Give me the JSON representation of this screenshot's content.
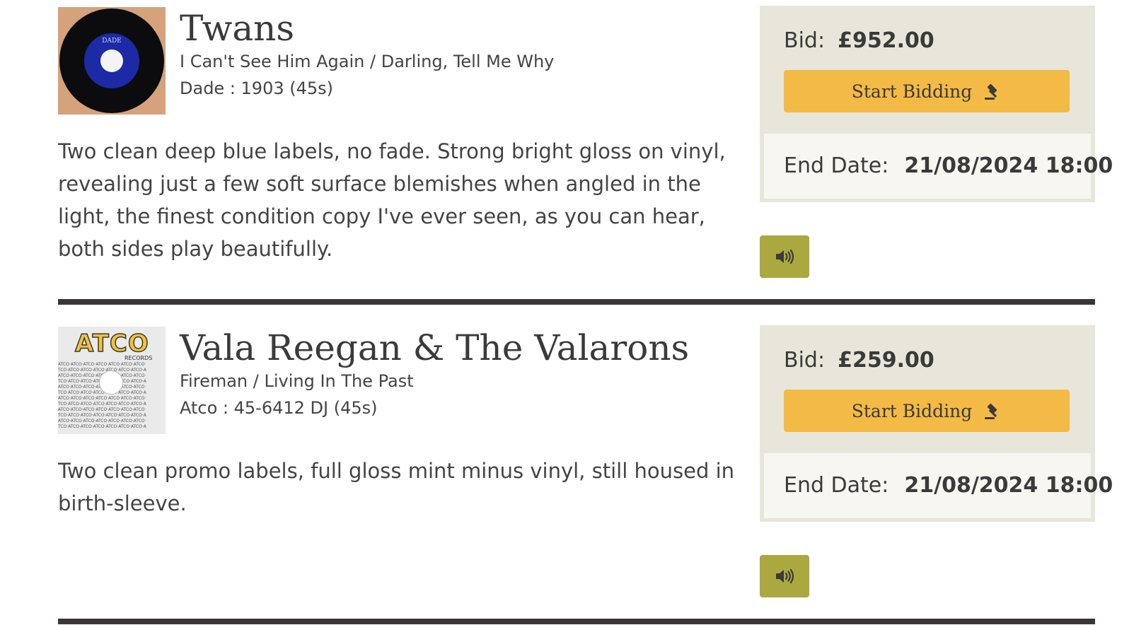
{
  "listings": [
    {
      "artist": "Twans",
      "titles": "I Can't See Him Again / Darling, Tell Me Why",
      "label_cat": "Dade : 1903 (45s)",
      "thumb_brand": "DADE",
      "description": "Two clean deep blue labels, no fade. Strong bright gloss on vinyl, revealing just a few soft surface blemishes when angled in the light, the finest condition copy I've ever seen, as you can hear, both sides play beautifully.",
      "bid_label": "Bid:",
      "bid_amount": "£952.00",
      "bid_button_label": "Start Bidding",
      "end_label": "End Date:",
      "end_value": "21/08/2024 18:00"
    },
    {
      "artist": "Vala Reegan & The Valarons",
      "titles": "Fireman / Living In The Past",
      "label_cat": "Atco : 45-6412 DJ (45s)",
      "thumb_brand": "ATCO",
      "thumb_records": "RECORDS",
      "description": "Two clean promo labels, full gloss mint minus vinyl, still housed in birth-sleeve.",
      "bid_label": "Bid:",
      "bid_amount": "£259.00",
      "bid_button_label": "Start Bidding",
      "end_label": "End Date:",
      "end_value": "21/08/2024 18:00"
    }
  ],
  "icons": {
    "bid_button_icon": "gavel-icon",
    "audio_button_icon": "speaker-volume-icon"
  },
  "colors": {
    "bid_button": "#f3ba45",
    "audio_button": "#aba840",
    "panel_background": "#e8e6da",
    "end_box_background": "#f7f6f1",
    "divider": "#3b3636",
    "text": "#3a3a3a"
  }
}
